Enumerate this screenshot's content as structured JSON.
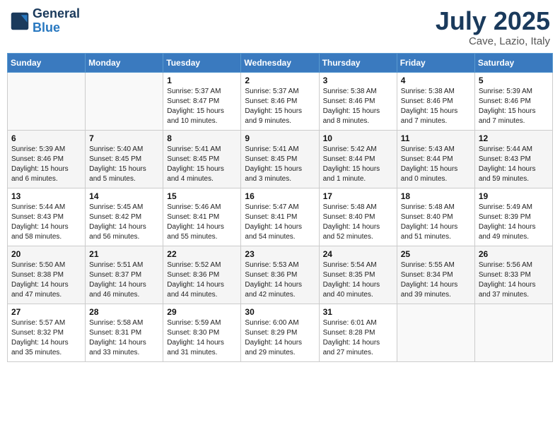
{
  "header": {
    "logo_line1": "General",
    "logo_line2": "Blue",
    "month": "July 2025",
    "location": "Cave, Lazio, Italy"
  },
  "weekdays": [
    "Sunday",
    "Monday",
    "Tuesday",
    "Wednesday",
    "Thursday",
    "Friday",
    "Saturday"
  ],
  "weeks": [
    [
      {
        "day": "",
        "info": ""
      },
      {
        "day": "",
        "info": ""
      },
      {
        "day": "1",
        "info": "Sunrise: 5:37 AM\nSunset: 8:47 PM\nDaylight: 15 hours\nand 10 minutes."
      },
      {
        "day": "2",
        "info": "Sunrise: 5:37 AM\nSunset: 8:46 PM\nDaylight: 15 hours\nand 9 minutes."
      },
      {
        "day": "3",
        "info": "Sunrise: 5:38 AM\nSunset: 8:46 PM\nDaylight: 15 hours\nand 8 minutes."
      },
      {
        "day": "4",
        "info": "Sunrise: 5:38 AM\nSunset: 8:46 PM\nDaylight: 15 hours\nand 7 minutes."
      },
      {
        "day": "5",
        "info": "Sunrise: 5:39 AM\nSunset: 8:46 PM\nDaylight: 15 hours\nand 7 minutes."
      }
    ],
    [
      {
        "day": "6",
        "info": "Sunrise: 5:39 AM\nSunset: 8:46 PM\nDaylight: 15 hours\nand 6 minutes."
      },
      {
        "day": "7",
        "info": "Sunrise: 5:40 AM\nSunset: 8:45 PM\nDaylight: 15 hours\nand 5 minutes."
      },
      {
        "day": "8",
        "info": "Sunrise: 5:41 AM\nSunset: 8:45 PM\nDaylight: 15 hours\nand 4 minutes."
      },
      {
        "day": "9",
        "info": "Sunrise: 5:41 AM\nSunset: 8:45 PM\nDaylight: 15 hours\nand 3 minutes."
      },
      {
        "day": "10",
        "info": "Sunrise: 5:42 AM\nSunset: 8:44 PM\nDaylight: 15 hours\nand 1 minute."
      },
      {
        "day": "11",
        "info": "Sunrise: 5:43 AM\nSunset: 8:44 PM\nDaylight: 15 hours\nand 0 minutes."
      },
      {
        "day": "12",
        "info": "Sunrise: 5:44 AM\nSunset: 8:43 PM\nDaylight: 14 hours\nand 59 minutes."
      }
    ],
    [
      {
        "day": "13",
        "info": "Sunrise: 5:44 AM\nSunset: 8:43 PM\nDaylight: 14 hours\nand 58 minutes."
      },
      {
        "day": "14",
        "info": "Sunrise: 5:45 AM\nSunset: 8:42 PM\nDaylight: 14 hours\nand 56 minutes."
      },
      {
        "day": "15",
        "info": "Sunrise: 5:46 AM\nSunset: 8:41 PM\nDaylight: 14 hours\nand 55 minutes."
      },
      {
        "day": "16",
        "info": "Sunrise: 5:47 AM\nSunset: 8:41 PM\nDaylight: 14 hours\nand 54 minutes."
      },
      {
        "day": "17",
        "info": "Sunrise: 5:48 AM\nSunset: 8:40 PM\nDaylight: 14 hours\nand 52 minutes."
      },
      {
        "day": "18",
        "info": "Sunrise: 5:48 AM\nSunset: 8:40 PM\nDaylight: 14 hours\nand 51 minutes."
      },
      {
        "day": "19",
        "info": "Sunrise: 5:49 AM\nSunset: 8:39 PM\nDaylight: 14 hours\nand 49 minutes."
      }
    ],
    [
      {
        "day": "20",
        "info": "Sunrise: 5:50 AM\nSunset: 8:38 PM\nDaylight: 14 hours\nand 47 minutes."
      },
      {
        "day": "21",
        "info": "Sunrise: 5:51 AM\nSunset: 8:37 PM\nDaylight: 14 hours\nand 46 minutes."
      },
      {
        "day": "22",
        "info": "Sunrise: 5:52 AM\nSunset: 8:36 PM\nDaylight: 14 hours\nand 44 minutes."
      },
      {
        "day": "23",
        "info": "Sunrise: 5:53 AM\nSunset: 8:36 PM\nDaylight: 14 hours\nand 42 minutes."
      },
      {
        "day": "24",
        "info": "Sunrise: 5:54 AM\nSunset: 8:35 PM\nDaylight: 14 hours\nand 40 minutes."
      },
      {
        "day": "25",
        "info": "Sunrise: 5:55 AM\nSunset: 8:34 PM\nDaylight: 14 hours\nand 39 minutes."
      },
      {
        "day": "26",
        "info": "Sunrise: 5:56 AM\nSunset: 8:33 PM\nDaylight: 14 hours\nand 37 minutes."
      }
    ],
    [
      {
        "day": "27",
        "info": "Sunrise: 5:57 AM\nSunset: 8:32 PM\nDaylight: 14 hours\nand 35 minutes."
      },
      {
        "day": "28",
        "info": "Sunrise: 5:58 AM\nSunset: 8:31 PM\nDaylight: 14 hours\nand 33 minutes."
      },
      {
        "day": "29",
        "info": "Sunrise: 5:59 AM\nSunset: 8:30 PM\nDaylight: 14 hours\nand 31 minutes."
      },
      {
        "day": "30",
        "info": "Sunrise: 6:00 AM\nSunset: 8:29 PM\nDaylight: 14 hours\nand 29 minutes."
      },
      {
        "day": "31",
        "info": "Sunrise: 6:01 AM\nSunset: 8:28 PM\nDaylight: 14 hours\nand 27 minutes."
      },
      {
        "day": "",
        "info": ""
      },
      {
        "day": "",
        "info": ""
      }
    ]
  ]
}
